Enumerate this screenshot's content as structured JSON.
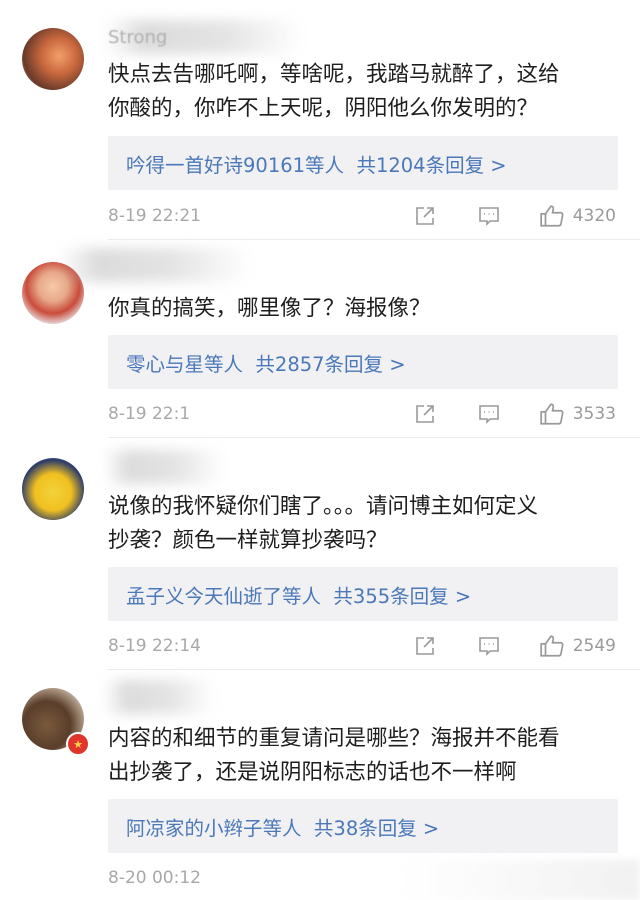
{
  "comments": [
    {
      "username": "Strong",
      "text_line1": "快点去告哪吒啊，等啥呢，我踏马就醉了，这给",
      "text_line2": "你酸的，你咋不上天呢，阴阳他么你发明的？",
      "reply_user": "吟得一首好诗90161等人",
      "reply_count": "共1204条回复 >",
      "time": "8-19 22:21",
      "likes": "4320"
    },
    {
      "username": "",
      "text_line1": "你真的搞笑，哪里像了？海报像？",
      "text_line2": "",
      "reply_user": "零心与星等人",
      "reply_count": "共2857条回复 >",
      "time": "8-19 22:1",
      "likes": "3533"
    },
    {
      "username": "",
      "text_line1": "说像的我怀疑你们瞎了。。。请问博主如何定义",
      "text_line2": "抄袭？颜色一样就算抄袭吗？",
      "reply_user": "孟子义今天仙逝了等人",
      "reply_count": "共355条回复 >",
      "time": "8-19 22:14",
      "likes": "2549"
    },
    {
      "username": "",
      "text_line1": "内容的和细节的重复请问是哪些？海报并不能看",
      "text_line2": "出抄袭了，还是说阴阳标志的话也不一样啊",
      "reply_user": "阿凉家的小辫子等人",
      "reply_count": "共38条回复 >",
      "time": "8-20 00:12",
      "likes": ""
    }
  ],
  "icons": {
    "share": "share-icon",
    "comment": "comment-icon",
    "like": "thumbs-up-icon"
  },
  "colors": {
    "link": "#4a78b8",
    "reply_bg": "#f1f1f3",
    "meta_text": "#a8a8a8"
  }
}
